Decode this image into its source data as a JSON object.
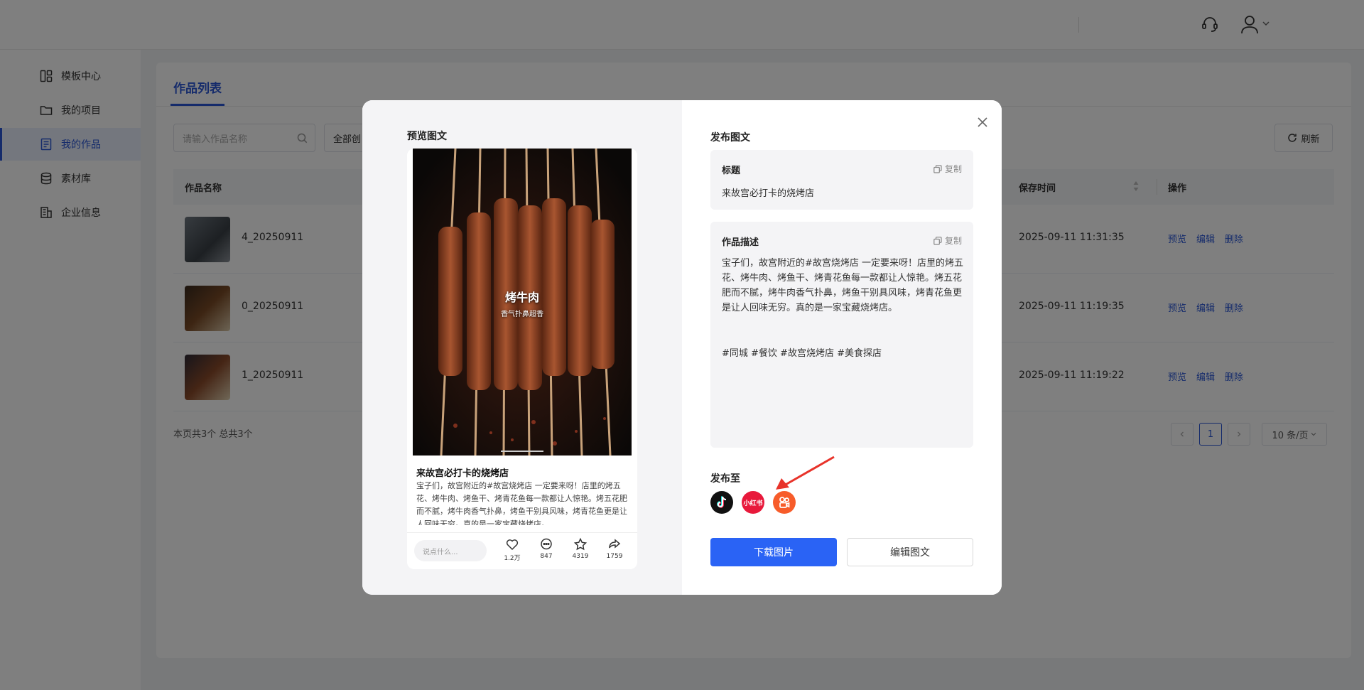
{
  "sidebar": {
    "items": [
      {
        "label": "模板中心",
        "icon": "template-icon"
      },
      {
        "label": "我的项目",
        "icon": "folder-icon"
      },
      {
        "label": "我的作品",
        "icon": "document-icon",
        "active": true
      },
      {
        "label": "素材库",
        "icon": "database-icon"
      },
      {
        "label": "企业信息",
        "icon": "building-icon"
      }
    ]
  },
  "main": {
    "tab": "作品列表",
    "search_placeholder": "请输入作品名称",
    "filter_value": "全部创",
    "refresh_label": "刷新",
    "columns": {
      "name": "作品名称",
      "save_time": "保存时间",
      "actions": "操作"
    },
    "rows": [
      {
        "name": "4_20250911",
        "time": "2025-09-11 11:31:35"
      },
      {
        "name": "0_20250911",
        "time": "2025-09-11 11:19:35"
      },
      {
        "name": "1_20250911",
        "time": "2025-09-11 11:19:22"
      }
    ],
    "row_actions": {
      "preview": "预览",
      "edit": "编辑",
      "delete": "删除"
    },
    "summary": "本页共3个 总共3个",
    "page": "1",
    "page_size": "10 条/页"
  },
  "modal": {
    "preview_title": "预览图文",
    "image_caption": "烤牛肉",
    "image_subcaption": "香气扑鼻超香",
    "post_title": "来故宫必打卡的烧烤店",
    "post_body": "宝子们，故宫附近的#故宫烧烤店 一定要来呀！店里的烤五花、烤牛肉、烤鱼干、烤青花鱼每一款都让人惊艳。烤五花肥而不腻，烤牛肉香气扑鼻，烤鱼干别具风味，烤青花鱼更是让人回味无穷。真的是一家宝藏烧烤店。",
    "comment_placeholder": "说点什么...",
    "stats": {
      "likes": "1.2万",
      "comments": "847",
      "favorites": "4319",
      "shares": "1759"
    },
    "publish_title": "发布图文",
    "title_label": "标题",
    "copy_label": "复制",
    "title_value": "来故宫必打卡的烧烤店",
    "desc_label": "作品描述",
    "desc_value": "宝子们，故宫附近的#故宫烧烤店 一定要来呀！店里的烤五花、烤牛肉、烤鱼干、烤青花鱼每一款都让人惊艳。烤五花肥而不腻，烤牛肉香气扑鼻，烤鱼干别具风味，烤青花鱼更是让人回味无穷。真的是一家宝藏烧烤店。",
    "desc_tags": "#同城 #餐饮 #故宫烧烤店 #美食探店",
    "publish_to": "发布至",
    "platforms": [
      {
        "name": "douyin-icon",
        "color": "#111111"
      },
      {
        "name": "xiaohongshu-icon",
        "label": "小红书",
        "color": "#e8193b"
      },
      {
        "name": "kuaishou-icon",
        "color": "#f75c2a"
      }
    ],
    "download_label": "下载图片",
    "edit_label": "编辑图文"
  }
}
